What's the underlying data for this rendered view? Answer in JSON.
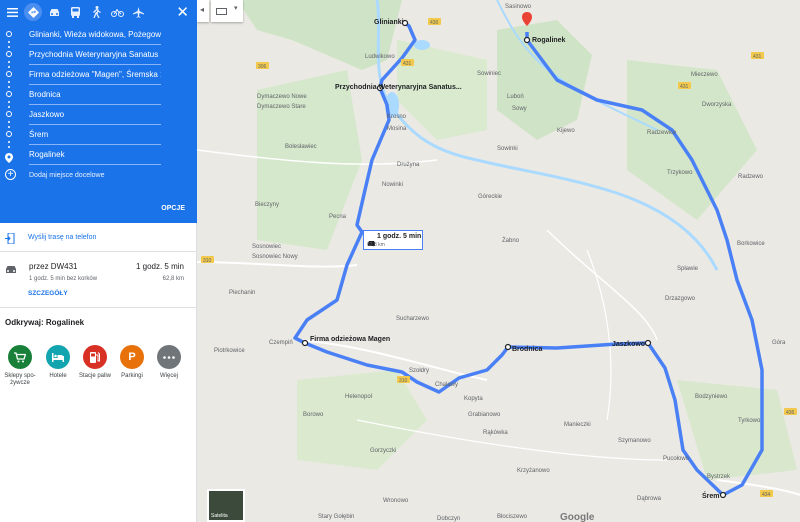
{
  "directions": {
    "waypoints": [
      "Glinianki, Wieża widokowa, Pożegowska",
      "Przychodnia Weterynaryjna Sanatus M.P",
      "Firma odzieżowa \"Magen\", Śremska 15,",
      "Brodnica",
      "Jaszkowo",
      "Śrem",
      "Rogalinek"
    ],
    "add_destination": "Dodaj miejsce docelowe",
    "options": "OPCJE",
    "send_to_phone": "Wyślij trasę na telefon"
  },
  "route": {
    "via": "przez DW431",
    "duration": "1 godz. 5 min",
    "traffic_note": "1 godz. 5 min bez korków",
    "distance": "62,8 km",
    "details": "SZCZEGÓŁY"
  },
  "discover": {
    "title": "Odkrywaj: Rogalinek",
    "categories": [
      {
        "label": "Sklepy spo-żywcze",
        "icon": "cart-icon",
        "color": "#188038"
      },
      {
        "label": "Hotele",
        "icon": "bed-icon",
        "color": "#12a4af"
      },
      {
        "label": "Stacje paliw",
        "icon": "fuel-icon",
        "color": "#d93025"
      },
      {
        "label": "Parkingi",
        "icon": "parking-icon",
        "color": "#e8710a"
      },
      {
        "label": "Więcej",
        "icon": "more-icon",
        "color": "#70757a"
      }
    ]
  },
  "map": {
    "route_label_time": "1 godz. 5 min",
    "route_label_distance": "62,8 km",
    "stops": [
      {
        "name": "Glinianki"
      },
      {
        "name": "Rogalinek"
      },
      {
        "name": "Przychodnia Weterynaryjna Sanatus..."
      },
      {
        "name": "Firma odzieżowa Magen"
      },
      {
        "name": "Brodnica"
      },
      {
        "name": "Jaszkowo"
      },
      {
        "name": "Śrem"
      }
    ],
    "places": [
      "Sasinowo",
      "Ludwikowo",
      "Sowiniec",
      "Dymaczewo Nowe",
      "Dymaczewo Stare",
      "Krosno",
      "Mosina",
      "Bolesławiec",
      "Drużyna",
      "Sowinki",
      "Nowinki",
      "Bieczyny",
      "Pecna",
      "Sosnowiec",
      "Sosnowiec Nowy",
      "Góreckie",
      "Dworzyska",
      "Radzewice",
      "Mieczewo",
      "Trzykowo",
      "Radzewo",
      "Żabno",
      "Piechanin",
      "Piotrkowice",
      "Czempiń",
      "Sucharzewo",
      "Szołdry",
      "Chaławy",
      "Kopyta",
      "Grabianowo",
      "Helenopol",
      "Borowo",
      "Rąkówka",
      "Gorzyczki",
      "Manieczki",
      "Szymanowo",
      "Krzyżanowo",
      "Wronowo",
      "Stary Gołębin",
      "Dobczyn",
      "Bodzyniewo",
      "Tyrkowo",
      "Pucołowo",
      "Bystrzek",
      "Borkowice",
      "Spławie",
      "Drzazgowo",
      "Góra",
      "Luboń",
      "Sowy",
      "Kijewo",
      "Błociszewo",
      "Dąbrowa"
    ],
    "roads": [
      "430",
      "431",
      "306",
      "310",
      "434",
      "436"
    ],
    "satellite_label": "Satelita",
    "logo": "Google"
  }
}
